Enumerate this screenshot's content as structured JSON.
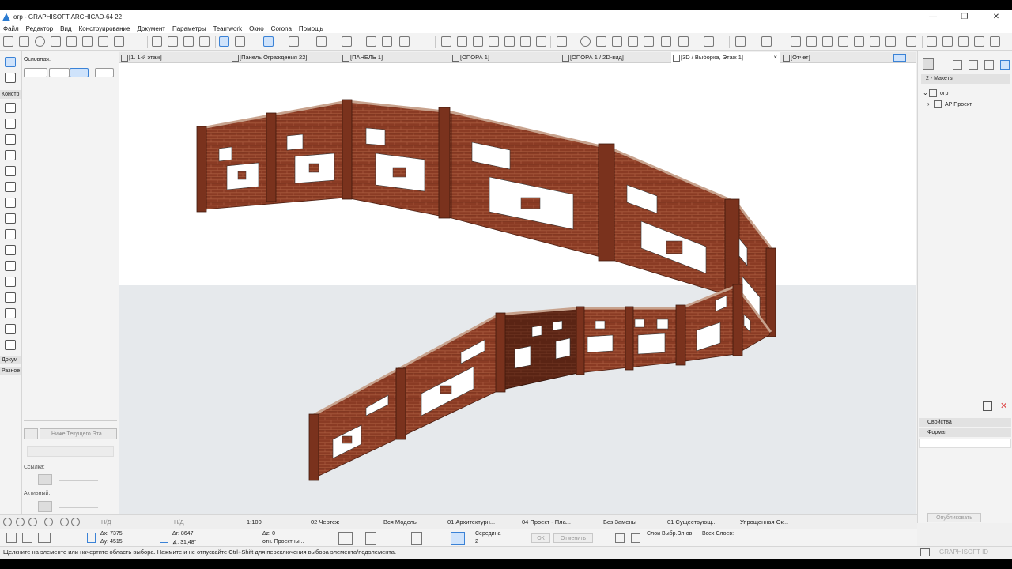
{
  "window": {
    "title": "огр - GRAPHISOFT ARCHICAD-64 22",
    "minimize": "—",
    "maximize": "❐",
    "close": "✕"
  },
  "menu": [
    "Файл",
    "Редактор",
    "Вид",
    "Конструирование",
    "Документ",
    "Параметры",
    "Teamwork",
    "Окно",
    "Corona",
    "Помощь"
  ],
  "toolbox": {
    "main_label": "Основная:",
    "design_section": "Констр",
    "docs_section": "Докум",
    "misc_section": "Разное"
  },
  "infobox": {
    "layer_dropdown": "Ниже Текущего Эта...",
    "link_label": "Ссылка:",
    "active_label": "Активный:"
  },
  "tabs": [
    {
      "label": "[1. 1-й этаж]"
    },
    {
      "label": "[Панель Ограждения 22]"
    },
    {
      "label": "[ПАНЕЛЬ 1]"
    },
    {
      "label": "[ОПОРА 1]"
    },
    {
      "label": "[ОПОРА 1 / 2D-вид]"
    },
    {
      "label": "[3D / Выборка, Этаж 1]",
      "close": "×"
    },
    {
      "label": "[Отчет]"
    }
  ],
  "navigator": {
    "dropdown": "2 - Макеты",
    "tree_root": "огр",
    "tree_child": "АР Проект",
    "properties": "Свойства",
    "format": "Формат",
    "publish_button": "Опубликовать",
    "brand": "GRAPHISOFT ID"
  },
  "status": {
    "nd1": "Н/Д",
    "nd2": "Н/Д",
    "scale": "1:100",
    "drawing": "02 Чертеж",
    "model": "Вся Модель",
    "layer": "01 Архитектурн...",
    "project": "04 Проект - Пла...",
    "replace": "Без Замены",
    "existing": "01 Существующ...",
    "simplified": "Упрощенная Ок..."
  },
  "coords": {
    "dx": "Δx: 7375",
    "dy": "Δy: 4515",
    "dr": "Δr: 8647",
    "angle": "∡: 31,48°",
    "dz": "Δz: 0",
    "rel": "отн. Проектны...",
    "middle": "Середина",
    "middle_val": "2",
    "ok": "ОК",
    "cancel": "Отменить",
    "layers_sel": "Слои Выбр.Эл-ов:",
    "all_layers": "Всех Слоев:"
  },
  "hint": "Щелкните на элементе или начертите область выбора. Нажмите и не отпускайте Ctrl+Shift для переключения выбора элемента/подэлемента.",
  "colors": {
    "brick": "#8a3b24",
    "brick_dark": "#5a2414",
    "sky": "#ffffff",
    "ground": "#e6e9ec",
    "accent": "#3a82d6"
  }
}
